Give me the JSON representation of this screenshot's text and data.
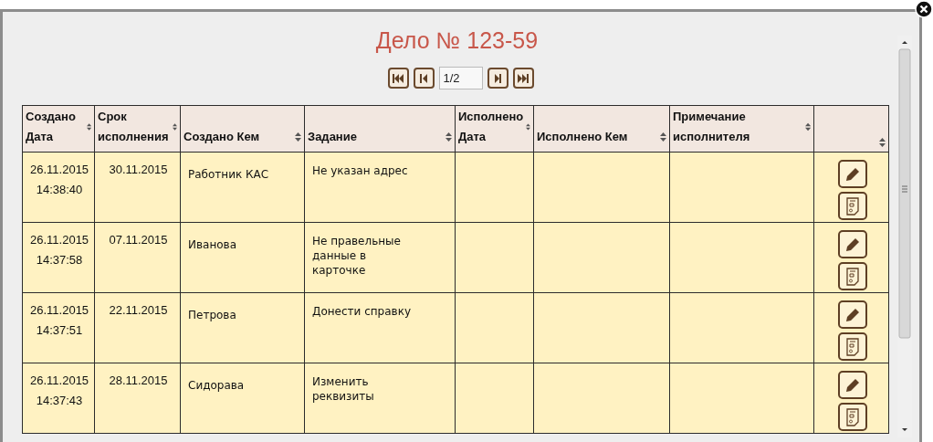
{
  "dialog": {
    "title": "Дело № 123-59"
  },
  "pager": {
    "page": "1/2"
  },
  "table": {
    "columns": [
      {
        "label": "Создано Дата"
      },
      {
        "label": "Срок исполнения"
      },
      {
        "label": "Создано Кем"
      },
      {
        "label": "Задание"
      },
      {
        "label": "Исполнено Дата"
      },
      {
        "label": "Исполнено Кем"
      },
      {
        "label": "Примечание исполнителя"
      },
      {}
    ],
    "rows": [
      {
        "created_date": "26.11.2015",
        "created_time": "14:38:40",
        "deadline": "30.11.2015",
        "created_by": "Работник КАС",
        "task": "Не указан адрес"
      },
      {
        "created_date": "26.11.2015",
        "created_time": "14:37:58",
        "deadline": "07.11.2015",
        "created_by": "Иванова",
        "task": "Не правельные данные в карточке"
      },
      {
        "created_date": "26.11.2015",
        "created_time": "14:37:51",
        "deadline": "22.11.2015",
        "created_by": "Петрова",
        "task": "Донести справку"
      },
      {
        "created_date": "26.11.2015",
        "created_time": "14:37:43",
        "deadline": "28.11.2015",
        "created_by": "Сидорава",
        "task": "Изменить реквизиты"
      }
    ]
  }
}
